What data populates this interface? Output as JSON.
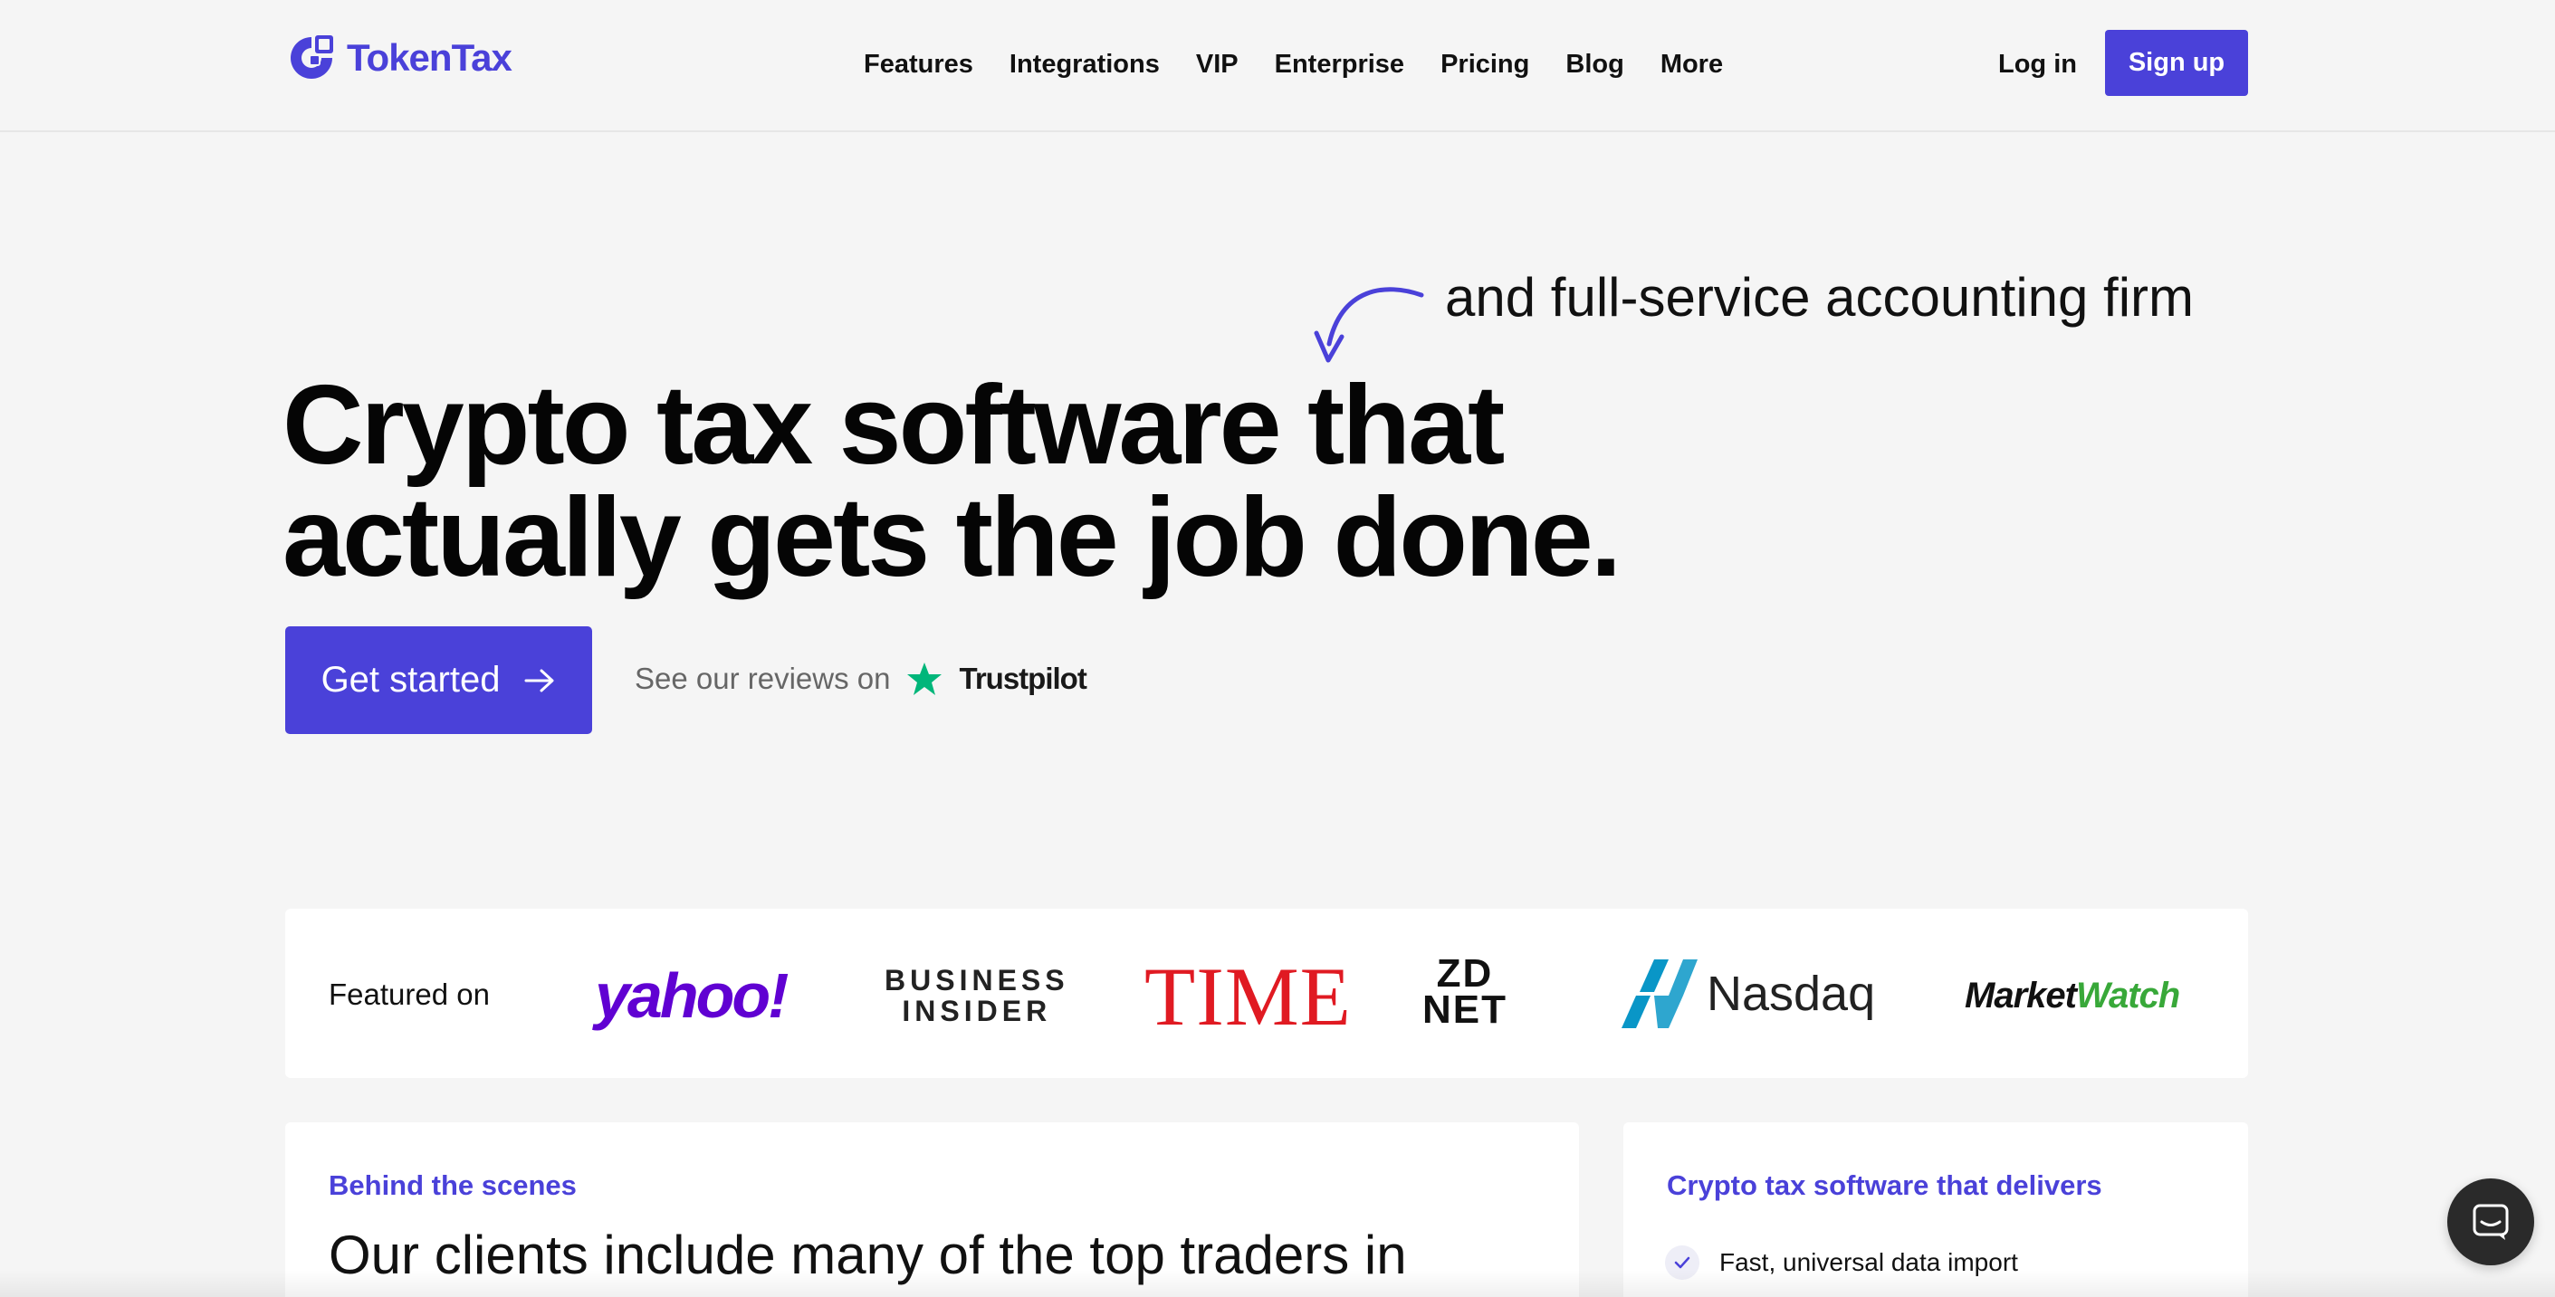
{
  "header": {
    "logo_text": "TokenTax",
    "nav": [
      "Features",
      "Integrations",
      "VIP",
      "Enterprise",
      "Pricing",
      "Blog",
      "More"
    ],
    "login_label": "Log in",
    "signup_label": "Sign up"
  },
  "hero": {
    "tagline": "and full-service accounting firm",
    "title_line1": "Crypto tax software that",
    "title_line2": "actually gets the job done.",
    "cta_label": "Get started",
    "reviews_text": "See our reviews on",
    "reviews_brand": "Trustpilot"
  },
  "featured": {
    "label": "Featured on",
    "yahoo": "yahoo!",
    "bi_line1": "BUSINESS",
    "bi_line2": "INSIDER",
    "time": "TIME",
    "zd_line1": "ZD",
    "zd_line2": "NET",
    "nasdaq": "Nasdaq",
    "mw_part1": "Market",
    "mw_part2": "Watch"
  },
  "cards": {
    "left_eyebrow": "Behind the scenes",
    "left_heading": "Our clients include many of the top traders in",
    "right_eyebrow": "Crypto tax software that delivers",
    "right_item1": "Fast, universal data import"
  },
  "colors": {
    "brand": "#4a41d9",
    "background": "#f5f5f5",
    "trustpilot_green": "#00b67a"
  },
  "icons": {
    "logo": "tokentax-logo-icon",
    "cta_arrow": "arrow-right-icon",
    "tagline_arrow": "curved-arrow-icon",
    "trustpilot": "star-icon",
    "check": "check-icon",
    "chat": "chat-icon"
  }
}
